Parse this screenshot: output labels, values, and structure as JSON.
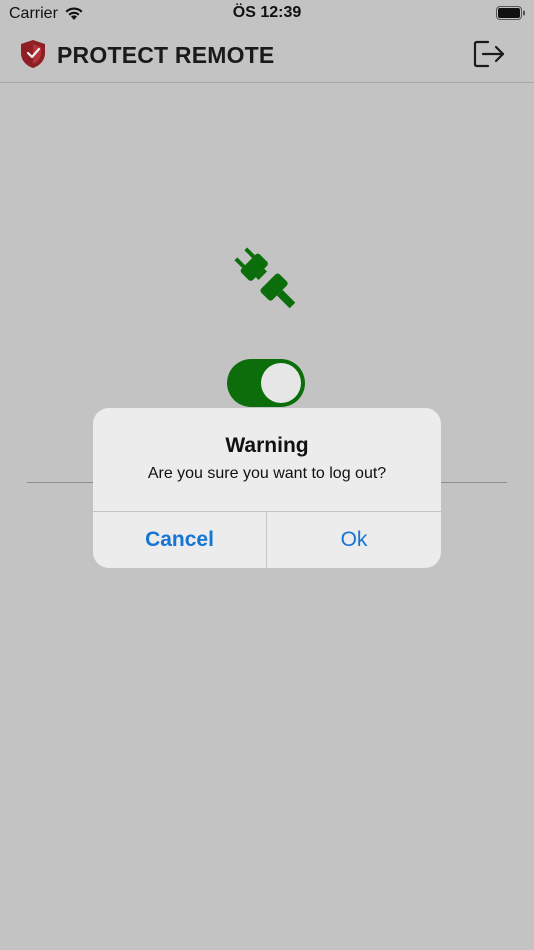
{
  "status_bar": {
    "carrier": "Carrier",
    "time": "ÖS 12:39"
  },
  "nav": {
    "app_title": "PROTECT REMOTE",
    "logo_icon": "shield-check-icon",
    "logout_icon": "logout-icon"
  },
  "main": {
    "plug_icon": "plug-connected-icon",
    "toggle_state": "on",
    "accent_color": "#0b6e0b"
  },
  "alert": {
    "title": "Warning",
    "message": "Are you sure you want to log out?",
    "cancel_label": "Cancel",
    "ok_label": "Ok",
    "button_color": "#1574d4"
  }
}
